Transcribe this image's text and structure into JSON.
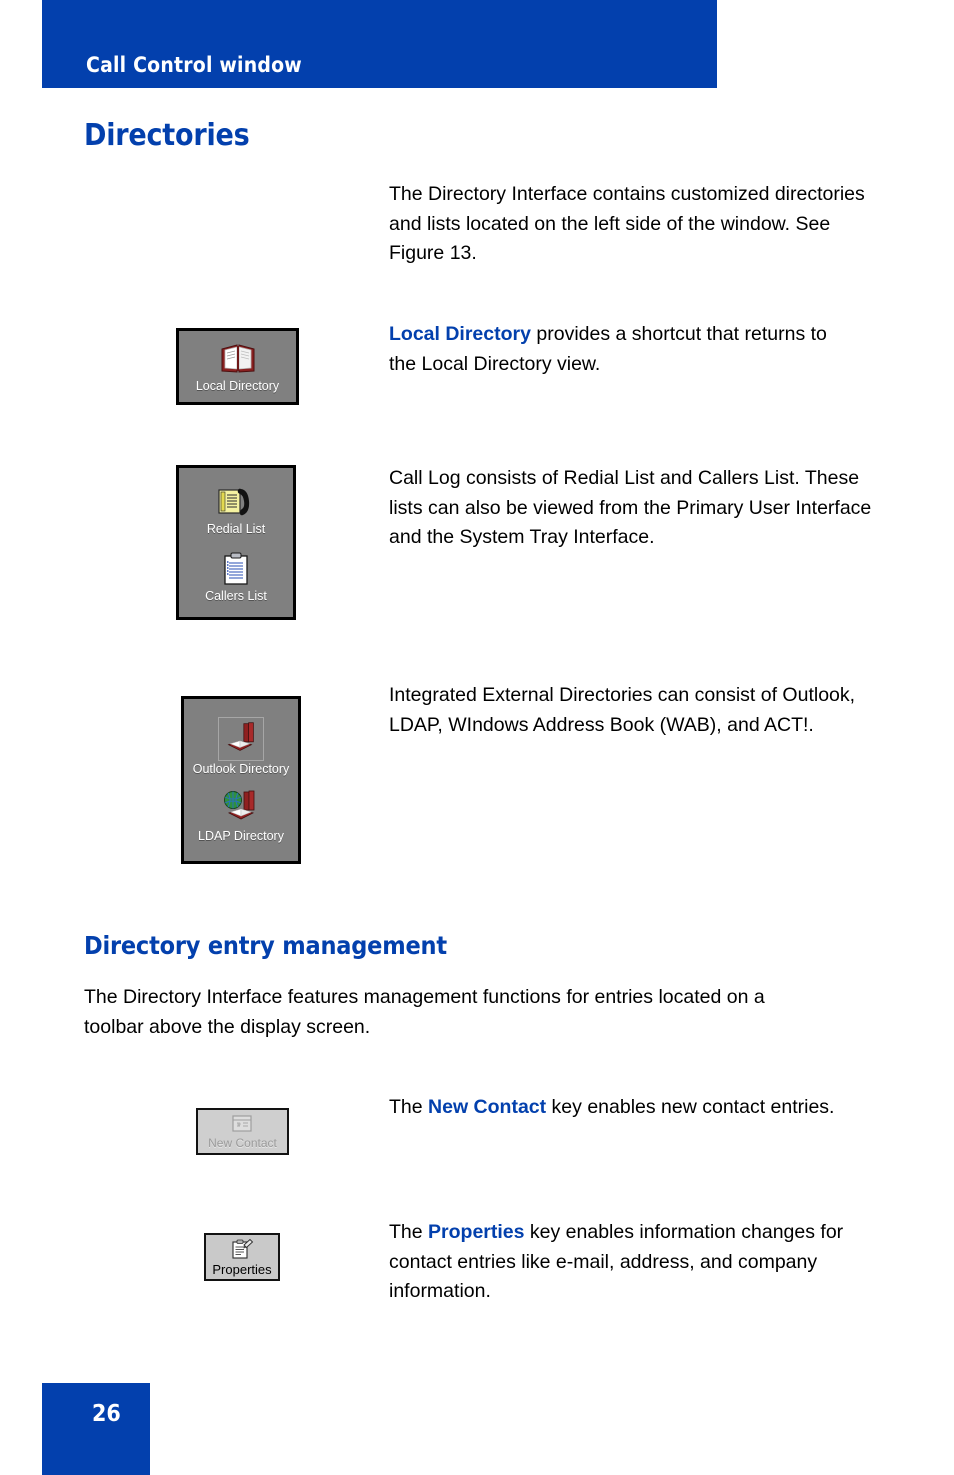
{
  "header": {
    "title": "Call Control window",
    "background_color": "#0340AD",
    "text_color": "#FFFFFF"
  },
  "sections": {
    "directories_heading": "Directories",
    "entry_management_heading": "Directory entry management"
  },
  "paragraphs": {
    "intro": "The Directory Interface contains customized directories and lists located on the left side of the window. See Figure 13.",
    "local_directory_lead": "Local Directory",
    "local_directory_rest": " provides a shortcut that returns to the Local Directory view.",
    "call_log": "Call Log consists of Redial List and Callers List. These lists can also be viewed from the Primary User Interface and the System Tray Interface.",
    "external_directories": "Integrated External Directories can consist of Outlook, LDAP, WIndows Address Book (WAB), and ACT!.",
    "management_intro": "The Directory Interface features management functions for entries located on a toolbar above the display screen.",
    "new_contact_pre": "The ",
    "new_contact_bold": "New Contact",
    "new_contact_post": " key enables new contact entries.",
    "properties_pre": "The ",
    "properties_bold": "Properties",
    "properties_post": " key enables information changes for contact entries like e-mail, address, and company information."
  },
  "icons": {
    "local_directory": {
      "caption": "Local Directory",
      "glyph": "open-book-icon"
    },
    "redial_list": {
      "caption": "Redial List",
      "glyph": "notepad-handset-icon"
    },
    "callers_list": {
      "caption": "Callers List",
      "glyph": "clipboard-icon"
    },
    "outlook_directory": {
      "caption": "Outlook Directory",
      "glyph": "books-open-book-icon"
    },
    "ldap_directory": {
      "caption": "LDAP Directory",
      "glyph": "globe-books-icon"
    },
    "new_contact": {
      "caption": "New Contact",
      "glyph": "contact-card-icon"
    },
    "properties": {
      "caption": "Properties",
      "glyph": "clipboard-pencil-icon"
    }
  },
  "footer": {
    "page_number": "26",
    "background_color": "#0340AD"
  }
}
